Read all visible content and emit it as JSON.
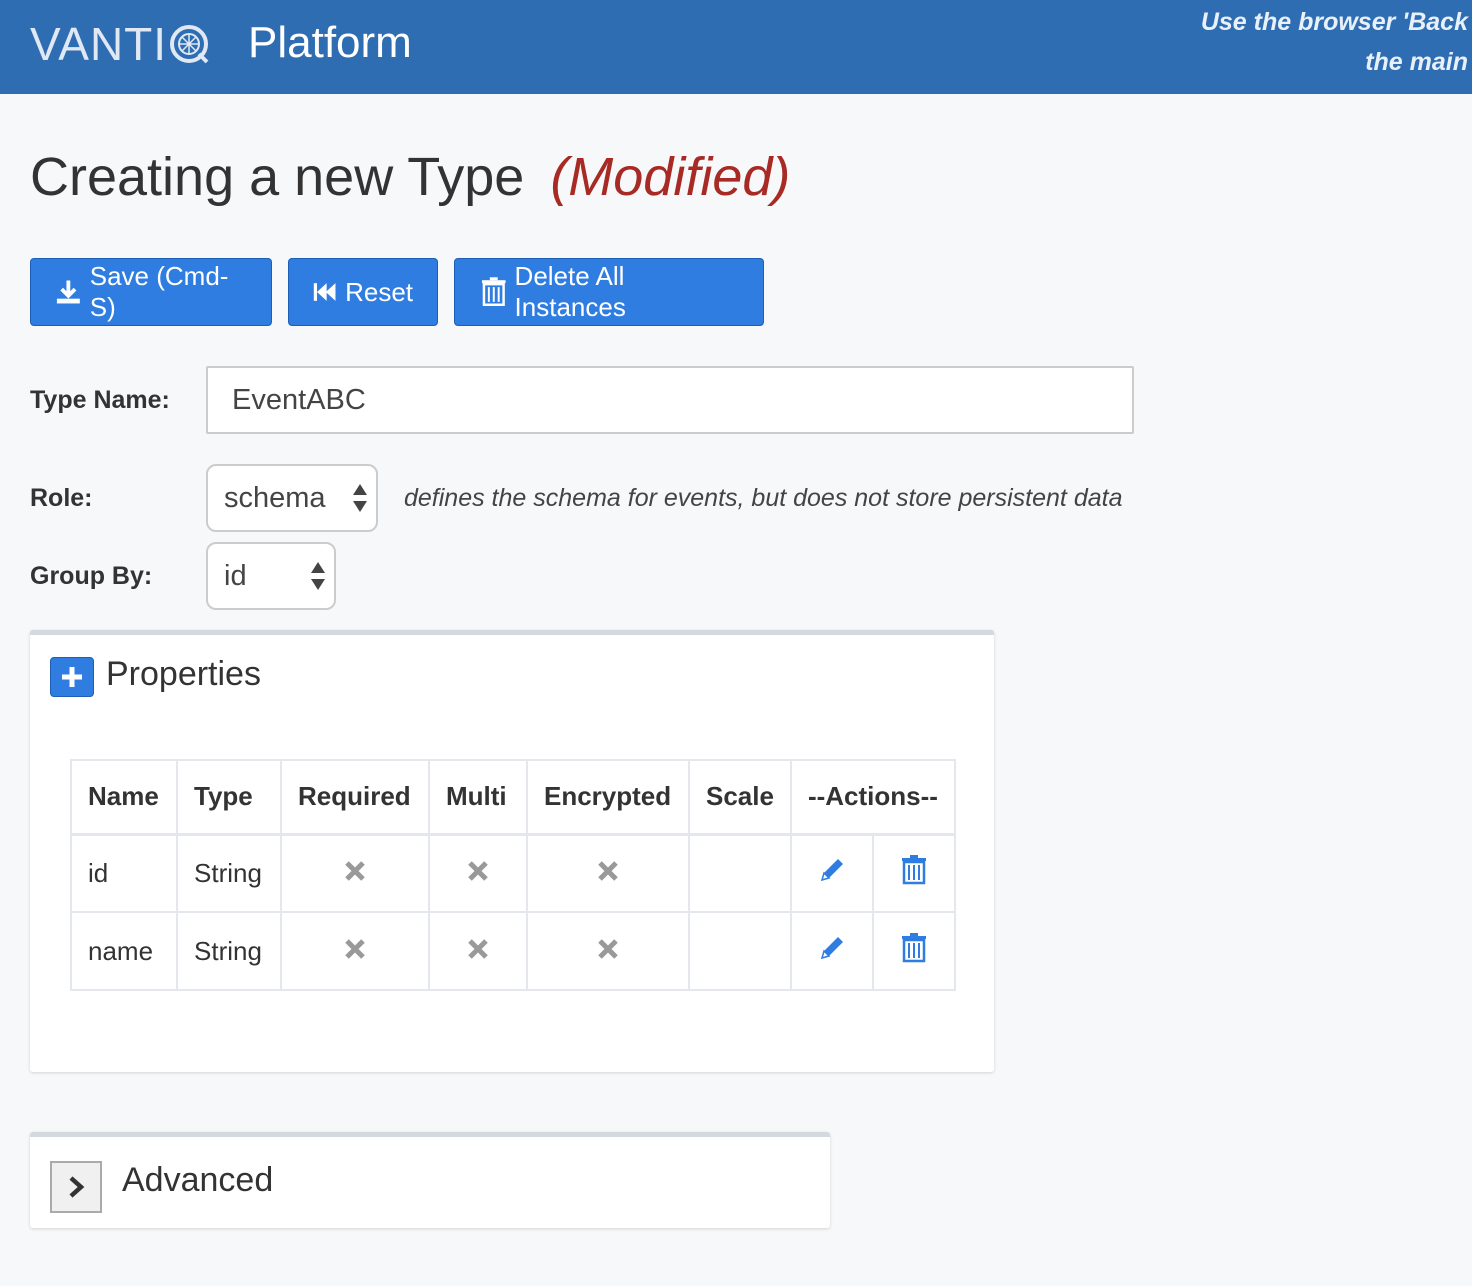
{
  "header": {
    "logo_text": "VANTI",
    "product": "Platform",
    "hint_line1": "Use the browser 'Back",
    "hint_line2": "the main"
  },
  "page": {
    "title": "Creating a new Type",
    "modified_flag": "(Modified)"
  },
  "toolbar": {
    "save_label": "Save (Cmd-S)",
    "reset_label": "Reset",
    "delete_label": "Delete All Instances"
  },
  "form": {
    "type_name_label": "Type Name:",
    "type_name_value": "EventABC",
    "role_label": "Role:",
    "role_value": "schema",
    "role_description": "defines the schema for events, but does not store persistent data",
    "group_by_label": "Group By:",
    "group_by_value": "id"
  },
  "properties": {
    "title": "Properties",
    "columns": [
      "Name",
      "Type",
      "Required",
      "Multi",
      "Encrypted",
      "Scale",
      "--Actions--"
    ],
    "rows": [
      {
        "name": "id",
        "type": "String",
        "required": false,
        "multi": false,
        "encrypted": false,
        "scale": ""
      },
      {
        "name": "name",
        "type": "String",
        "required": false,
        "multi": false,
        "encrypted": false,
        "scale": ""
      }
    ]
  },
  "advanced": {
    "title": "Advanced"
  },
  "colors": {
    "header_bg": "#2f6db3",
    "button_blue": "#2f7de1",
    "modified_red": "#a82a24",
    "action_icon_blue": "#2f7de1"
  },
  "icons": {
    "save": "download-icon",
    "reset": "fast-backward-icon",
    "delete": "trash-icon",
    "add": "plus-icon",
    "expand": "chevron-right-icon",
    "edit": "pencil-icon",
    "remove": "trash-icon",
    "false_value": "x-icon"
  }
}
